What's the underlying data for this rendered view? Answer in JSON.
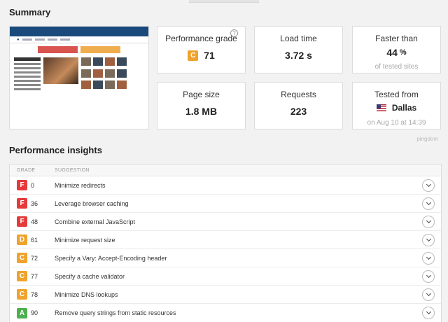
{
  "summary": {
    "title": "Summary",
    "cards": {
      "performance_grade": {
        "label": "Performance grade",
        "grade": "C",
        "value": "71",
        "grade_color": "#f0a32c"
      },
      "load_time": {
        "label": "Load time",
        "value": "3.72 s"
      },
      "faster_than": {
        "label": "Faster than",
        "value": "44",
        "unit": "%",
        "sub": "of tested sites"
      },
      "page_size": {
        "label": "Page size",
        "value": "1.8 MB"
      },
      "requests": {
        "label": "Requests",
        "value": "223"
      },
      "tested_from": {
        "label": "Tested from",
        "city": "Dallas",
        "sub": "on Aug 10 at 14:39"
      }
    },
    "branding": "pingdom"
  },
  "insights": {
    "title": "Performance insights",
    "columns": {
      "grade": "GRADE",
      "suggestion": "SUGGESTION"
    },
    "colors": {
      "F": "#e5393a",
      "D": "#f0a32c",
      "C": "#f0a32c",
      "A": "#4caf50"
    },
    "rows": [
      {
        "grade": "F",
        "score": "0",
        "suggestion": "Minimize redirects"
      },
      {
        "grade": "F",
        "score": "36",
        "suggestion": "Leverage browser caching"
      },
      {
        "grade": "F",
        "score": "48",
        "suggestion": "Combine external JavaScript"
      },
      {
        "grade": "D",
        "score": "61",
        "suggestion": "Minimize request size"
      },
      {
        "grade": "C",
        "score": "72",
        "suggestion": "Specify a Vary: Accept-Encoding header"
      },
      {
        "grade": "C",
        "score": "77",
        "suggestion": "Specify a cache validator"
      },
      {
        "grade": "C",
        "score": "78",
        "suggestion": "Minimize DNS lookups"
      },
      {
        "grade": "A",
        "score": "90",
        "suggestion": "Remove query strings from static resources"
      }
    ]
  }
}
